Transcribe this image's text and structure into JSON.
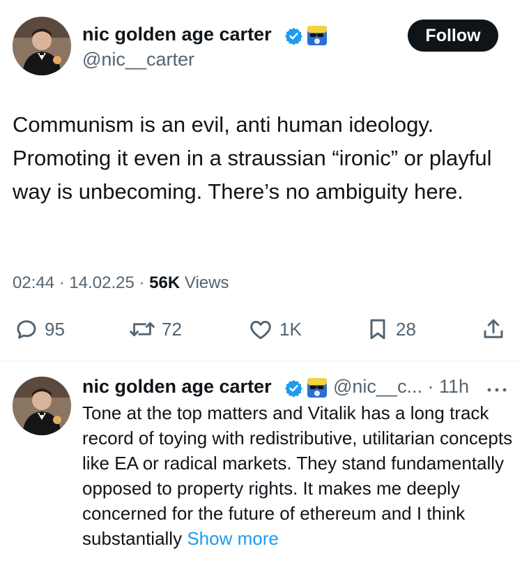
{
  "main_tweet": {
    "author_name": "nic golden age carter",
    "handle": "@nic__carter",
    "follow_label": "Follow",
    "text": "Communism is an evil, anti human ideology. Promoting it even in a straussian “ironic” or playful way is unbecoming. There’s no ambiguity here.",
    "time": "02:44",
    "date": "14.02.25",
    "views_count": "56K",
    "views_label": "Views",
    "separator": "·",
    "actions": {
      "replies": "95",
      "reposts": "72",
      "likes": "1K",
      "bookmarks": "28"
    }
  },
  "reply": {
    "author_name": "nic golden age carter",
    "handle": "@nic__c...",
    "separator": "·",
    "time_ago": "11h",
    "text": "Tone at the top matters and Vitalik has a long track record of toying with redistributive, utilitarian concepts like EA or radical markets. They stand fundamentally opposed to property rights. It makes me deeply concerned for the future of ethereum and I think substantially",
    "show_more": "Show more"
  },
  "colors": {
    "text": "#0f1419",
    "secondary": "#536471",
    "accent": "#1d9bf0",
    "follow_bg": "#0f1419"
  },
  "icons": [
    "verified-badge-icon",
    "sunglasses-emoji-icon",
    "reply-icon",
    "repost-icon",
    "like-icon",
    "bookmark-icon",
    "share-icon",
    "more-icon"
  ]
}
